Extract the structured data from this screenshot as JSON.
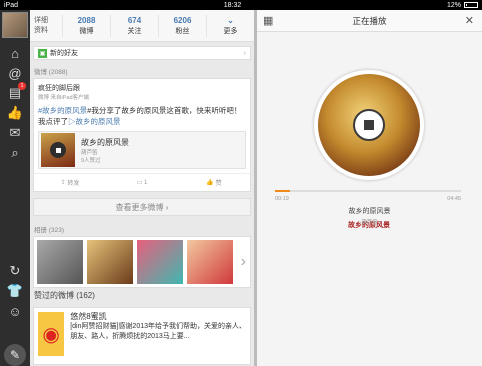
{
  "status": {
    "device": "iPad",
    "time": "18:32",
    "battery": "12%"
  },
  "profile": {
    "name_line1": "详细",
    "name_line2": "资料",
    "stats": [
      {
        "count": "2088",
        "label": "微博"
      },
      {
        "count": "674",
        "label": "关注"
      },
      {
        "count": "6206",
        "label": "粉丝"
      },
      {
        "count": "",
        "label": "更多"
      }
    ]
  },
  "sidebar": {
    "notify_badge": "1"
  },
  "feed": {
    "new_friends": "新的好友",
    "weibo_section": "微博 (2088)",
    "post": {
      "author": "疯狂的脚后跟",
      "source": "微博  来自iPad客户端",
      "text_tag": "#故乡的原风景",
      "text_body": "#我分享了故乡的原风景这首歌，快来听听吧！我点评了",
      "text_tail": "▷故乡的原风景",
      "music_title": "故乡的原风景",
      "music_artist": "葫芦笛",
      "music_likes": "9人赞过",
      "repost": "转发",
      "comment": "1",
      "like": "赞"
    },
    "more": "查看更多微博 ›",
    "album_section": "相册 (323)",
    "liked_section": "赞过的微博 (162)",
    "liked_author": "悠然8蜜凯",
    "liked_text": "[din阿赞招财猫]感谢2013年给予我们帮助，关爱的亲人、朋友、路人，折腾烦扰的2013马上要..."
  },
  "player": {
    "title": "正在播放",
    "elapsed": "00:19",
    "duration": "04:45",
    "song": "故乡的原风景",
    "artist": "葫芦笛",
    "progress": 0.08,
    "disc_label": "故乡的原风景"
  },
  "colors": {
    "accent": "#f08a1a",
    "link": "#4a7bb0",
    "sidebar": "#2e2e2e"
  }
}
